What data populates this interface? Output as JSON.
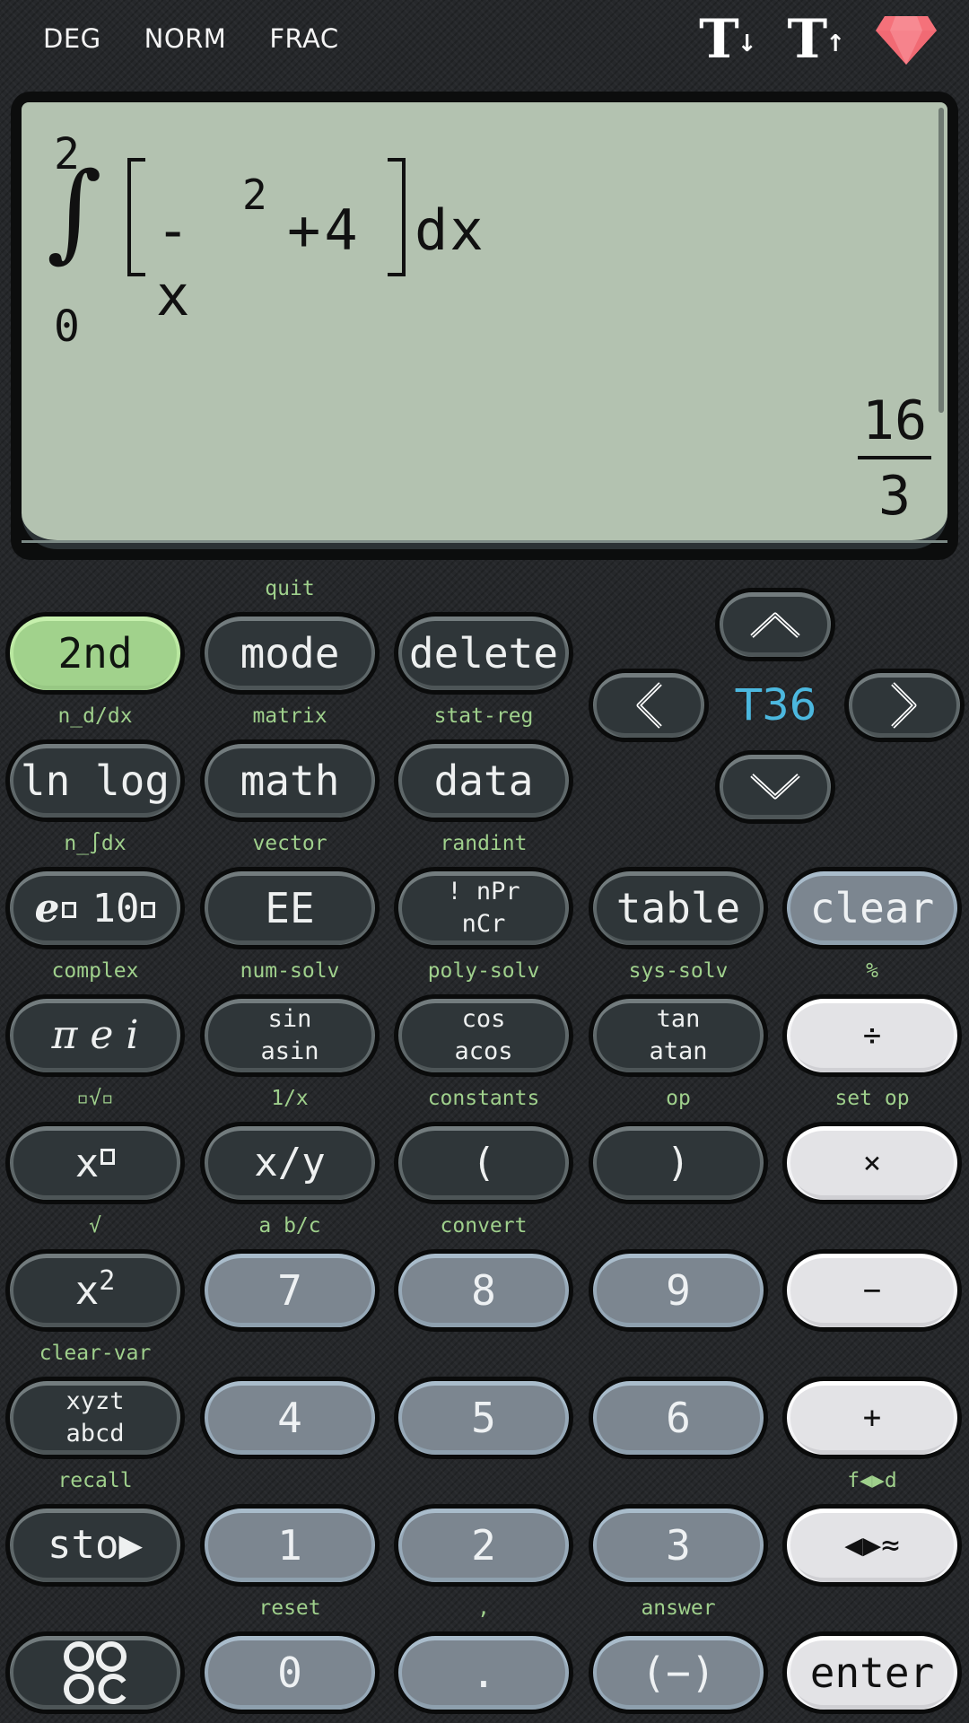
{
  "status_bar": {
    "angle_mode": "DEG",
    "number_mode": "NORM",
    "result_mode": "FRAC",
    "icons": [
      "text-size-decrease-icon",
      "text-size-increase-icon",
      "premium-gem-icon"
    ],
    "gem_color": "#f5717a"
  },
  "display": {
    "expression": {
      "operator": "∫",
      "upper_limit": "2",
      "lower_limit": "0",
      "integrand_prefix": "-x",
      "integrand_exponent": "2",
      "integrand_suffix": "+4",
      "differential": "dx"
    },
    "result": {
      "numerator": "16",
      "denominator": "3"
    },
    "background_color": "#b3c2b0"
  },
  "navigation": {
    "up_icon": "chevron-up-icon",
    "down_icon": "chevron-down-icon",
    "left_icon": "chevron-left-icon",
    "right_icon": "chevron-right-icon",
    "tape_indicator": "T36",
    "tape_indicator_color": "#4cb8df"
  },
  "keys": {
    "second": {
      "label": "2nd"
    },
    "mode": {
      "label": "mode",
      "secondary": "quit"
    },
    "delete": {
      "label": "delete"
    },
    "lnlog": {
      "label": "ln log",
      "secondary": "n_d/dx"
    },
    "math": {
      "label": "math",
      "secondary": "matrix"
    },
    "data": {
      "label": "data",
      "secondary": "stat-reg"
    },
    "exp": {
      "label_e": "e",
      "label_10": "10",
      "secondary": "n_∫dx"
    },
    "ee": {
      "label": "EE",
      "secondary": "vector"
    },
    "prob": {
      "line1": "! nPr",
      "line2": "nCr",
      "secondary": "randint"
    },
    "table": {
      "label": "table"
    },
    "clear": {
      "label": "clear"
    },
    "pie": {
      "label": "π e i",
      "secondary": "complex"
    },
    "sin": {
      "line1": "sin",
      "line2": "asin",
      "secondary": "num-solv"
    },
    "cos": {
      "line1": "cos",
      "line2": "acos",
      "secondary": "poly-solv"
    },
    "tan": {
      "line1": "tan",
      "line2": "atan",
      "secondary": "sys-solv"
    },
    "divide": {
      "label": "÷",
      "secondary": "%"
    },
    "power": {
      "label": "x",
      "secondary": "▫√▫"
    },
    "frac": {
      "label": "x/y",
      "secondary": "1/x"
    },
    "lparen": {
      "label": "(",
      "secondary": "constants"
    },
    "rparen": {
      "label": ")",
      "secondary": "op"
    },
    "multiply": {
      "label": "×",
      "secondary": "set op"
    },
    "square": {
      "label": "x",
      "exponent": "2",
      "secondary": "√"
    },
    "seven": {
      "label": "7",
      "secondary": "a b/c"
    },
    "eight": {
      "label": "8",
      "secondary": "convert"
    },
    "nine": {
      "label": "9"
    },
    "minus": {
      "label": "−"
    },
    "vars": {
      "line1": "xyzt",
      "line2": "abcd",
      "secondary": "clear-var"
    },
    "four": {
      "label": "4"
    },
    "five": {
      "label": "5"
    },
    "six": {
      "label": "6"
    },
    "plus": {
      "label": "+"
    },
    "sto": {
      "label": "sto▶",
      "secondary": "recall"
    },
    "one": {
      "label": "1"
    },
    "two": {
      "label": "2"
    },
    "three": {
      "label": "3"
    },
    "approx": {
      "label": "◀▶≈",
      "secondary": "f◀▶d"
    },
    "menu": {
      "icon": "apps-grid-icon"
    },
    "zero": {
      "label": "0",
      "secondary": "reset"
    },
    "dot": {
      "label": ".",
      "secondary": ","
    },
    "neg": {
      "label": "(−)",
      "secondary": "answer"
    },
    "enter": {
      "label": "enter"
    }
  }
}
